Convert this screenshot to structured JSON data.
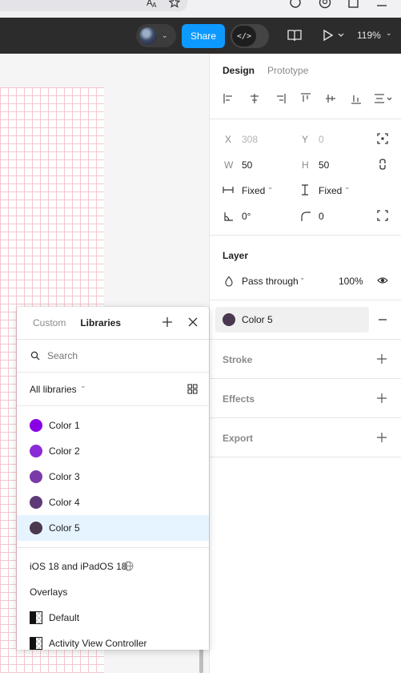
{
  "toolbar": {
    "share_label": "Share",
    "zoom": "119%"
  },
  "panel": {
    "tabs": [
      "Design",
      "Prototype"
    ],
    "position": {
      "x_label": "X",
      "x_value": "308",
      "y_label": "Y",
      "y_value": "0"
    },
    "size": {
      "w_label": "W",
      "w_value": "50",
      "h_label": "H",
      "h_value": "50"
    },
    "resizing": {
      "horizontal": "Fixed",
      "vertical": "Fixed"
    },
    "rotation": "0°",
    "corner_radius": "0",
    "layer": {
      "title": "Layer",
      "blend": "Pass through",
      "opacity": "100%"
    },
    "fill": {
      "name": "Color 5",
      "color": "#4a3750"
    },
    "sections": [
      "Stroke",
      "Effects",
      "Export"
    ]
  },
  "library_popup": {
    "tabs": [
      "Custom",
      "Libraries"
    ],
    "search_placeholder": "Search",
    "filter": "All libraries",
    "colors": [
      {
        "name": "Color 1",
        "color": "#8a00e6"
      },
      {
        "name": "Color 2",
        "color": "#8a2bd6"
      },
      {
        "name": "Color 3",
        "color": "#7a3aa8"
      },
      {
        "name": "Color 4",
        "color": "#5e3a78"
      },
      {
        "name": "Color 5",
        "color": "#4a3750"
      }
    ],
    "selected_index": 4,
    "library_name": "iOS 18 and iPadOS 18",
    "group_name": "Overlays",
    "components": [
      "Default",
      "Activity View Controller"
    ]
  }
}
